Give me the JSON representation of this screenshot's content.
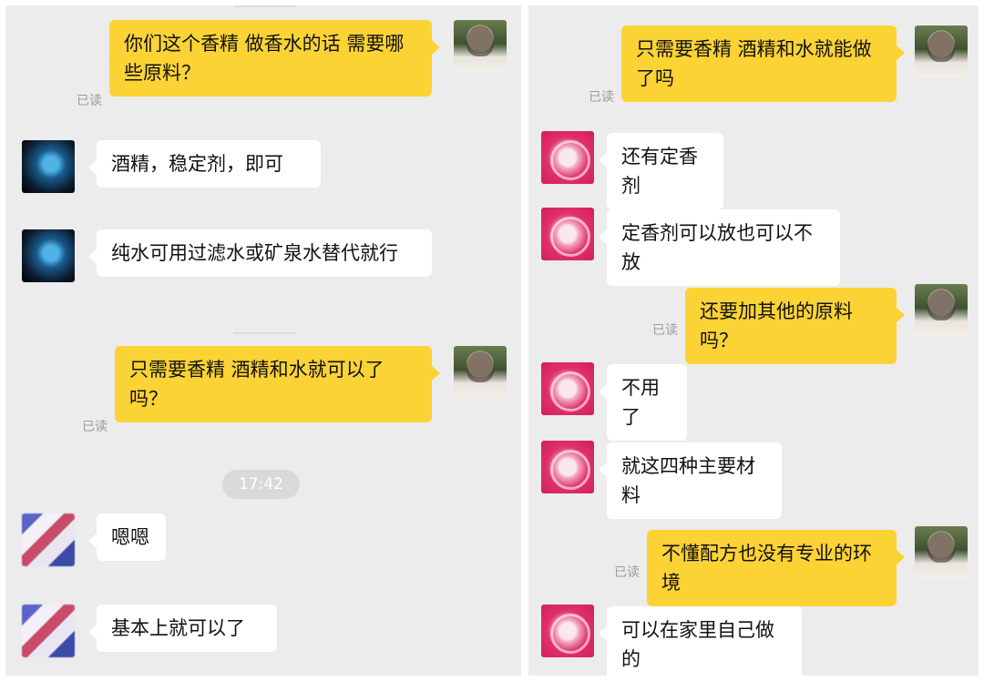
{
  "left_chat": {
    "messages": [
      {
        "text": "你们这个香精 做香水的话 需要哪些原料？",
        "read": "已读"
      },
      {
        "text": "酒精，稳定剂，即可"
      },
      {
        "text": "纯水可用过滤水或矿泉水替代就行"
      },
      {
        "text": "只需要香精 酒精和水就可以了吗？",
        "read": "已读"
      },
      {
        "text": "嗯嗯"
      },
      {
        "text": "基本上就可以了"
      }
    ],
    "timestamp": "17:42"
  },
  "right_chat": {
    "messages": [
      {
        "text": "只需要香精 酒精和水就能做了吗",
        "read": "已读"
      },
      {
        "text": "还有定香剂"
      },
      {
        "text": "定香剂可以放也可以不放"
      },
      {
        "text": "还要加其他的原料吗？",
        "read": "已读"
      },
      {
        "text": "不用了"
      },
      {
        "text": "就这四种主要材料"
      },
      {
        "text": "不懂配方也没有专业的环境",
        "read": "已读"
      },
      {
        "text": "可以在家里自己做的"
      }
    ]
  },
  "colors": {
    "outgoing_bubble": "#fcd335",
    "incoming_bubble": "#ffffff",
    "chat_background": "#ececec",
    "read_receipt": "#9b9b9b"
  },
  "icons": {
    "self_avatar": "user-photo-avatar",
    "left_contact_avatar_1": "blue-abstract-avatar",
    "left_contact_avatar_2": "anime-avatar",
    "right_contact_avatar": "pink-emblem-avatar"
  }
}
